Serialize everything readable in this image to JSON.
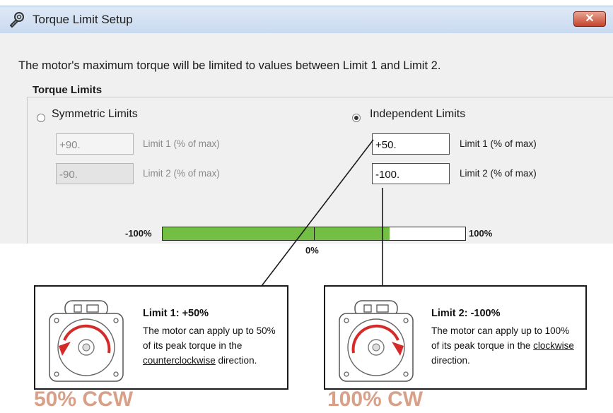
{
  "window": {
    "title": "Torque Limit Setup",
    "close_label": "✕"
  },
  "description": "The motor's maximum torque will be limited to values between Limit 1 and Limit 2.",
  "torque_limits": {
    "group_label": "Torque Limits",
    "symmetric": {
      "label": "Symmetric Limits",
      "selected": false,
      "limit1_value": "+90.",
      "limit1_label": "Limit 1 (% of max)",
      "limit2_value": "-90.",
      "limit2_label": "Limit 2 (% of max)"
    },
    "independent": {
      "label": "Independent Limits",
      "selected": true,
      "limit1_value": "+50.",
      "limit1_label": "Limit 1 (% of max)",
      "limit2_value": "-100.",
      "limit2_label": "Limit 2 (% of max)"
    }
  },
  "range_bar": {
    "min_label": "-100%",
    "max_label": "100%",
    "mid_label": "0%",
    "fill_from_percent": -100,
    "fill_to_percent": 50,
    "colors": {
      "fill": "#72bf44"
    }
  },
  "callouts": {
    "limit1": {
      "title": "Limit 1: +50%",
      "body_prefix": "The motor can apply up to 50% of its peak torque in the ",
      "direction": "counterclockwise",
      "body_suffix": " direction.",
      "icon": "motor-ccw-icon"
    },
    "limit2": {
      "title": "Limit 2: -100%",
      "body_prefix": "The motor can apply up to 100% of its peak torque in the ",
      "direction": "clockwise",
      "body_suffix": " direction.",
      "icon": "motor-cw-icon"
    }
  },
  "captions": {
    "ccw": "50% CCW",
    "cw": "100% CW"
  },
  "colors": {
    "caption": "#d9a088",
    "arrow": "#d42a2a"
  }
}
